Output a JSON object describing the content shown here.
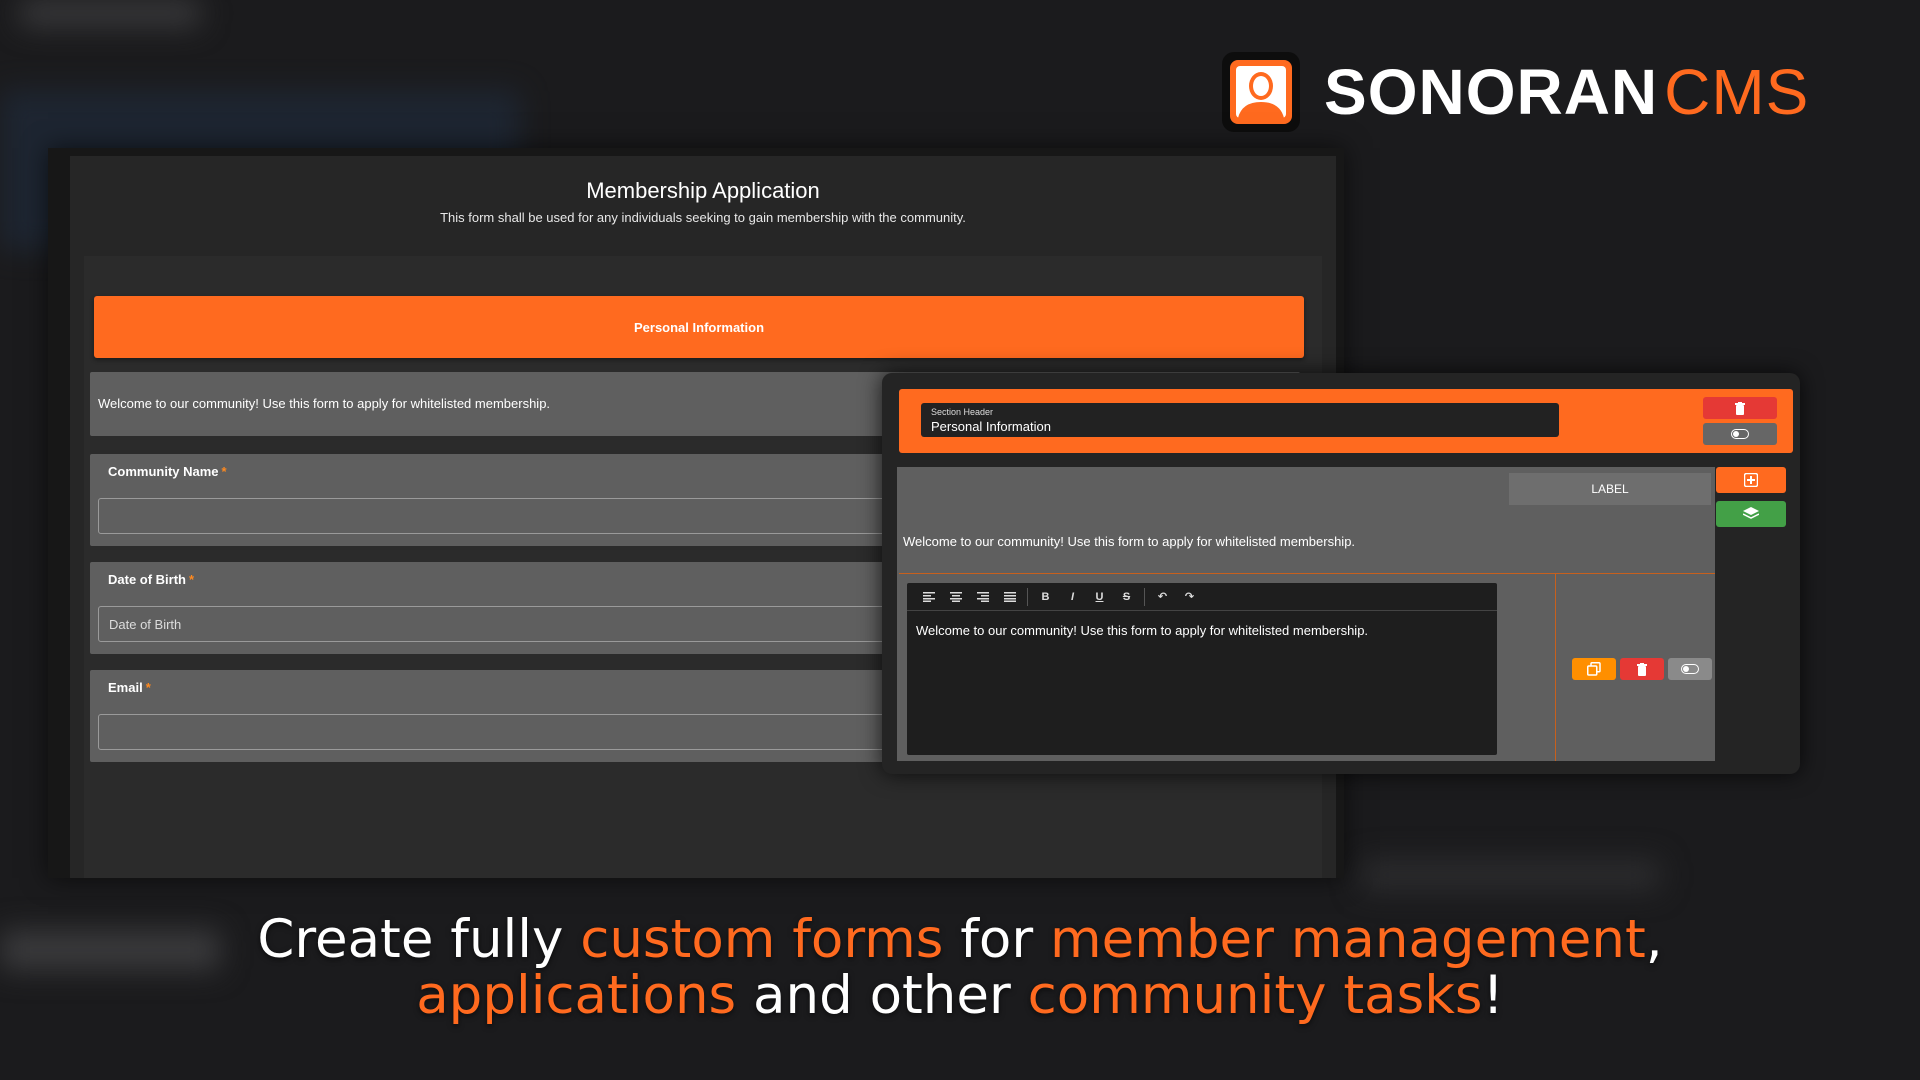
{
  "brand": {
    "word1": "SONORAN",
    "word2": "CMS",
    "accent": "#ff6a1f"
  },
  "form": {
    "title": "Membership Application",
    "subtitle": "This form shall be used for any individuals seeking to gain membership with the community.",
    "section_header": "Personal Information",
    "welcome_text": "Welcome to our community! Use this form to apply for whitelisted membership.",
    "fields": [
      {
        "label": "Community Name",
        "required_mark": "*",
        "placeholder": "",
        "value": ""
      },
      {
        "label": "Date of Birth",
        "required_mark": "*",
        "placeholder": "Date of Birth",
        "value": ""
      },
      {
        "label": "Email",
        "required_mark": "*",
        "placeholder": "",
        "value": ""
      }
    ]
  },
  "editor": {
    "header_field_label": "Section Header",
    "header_field_value": "Personal Information",
    "label_button": "LABEL",
    "content_text": "Welcome to our community! Use this form to apply for whitelisted membership.",
    "rte_text": "Welcome to our community! Use this form to apply for whitelisted membership.",
    "toolbar": [
      {
        "name": "align-left-icon",
        "glyph": "≡"
      },
      {
        "name": "align-center-icon",
        "glyph": "≡"
      },
      {
        "name": "align-right-icon",
        "glyph": "≡"
      },
      {
        "name": "align-justify-icon",
        "glyph": "≡"
      },
      {
        "name": "bold-icon",
        "glyph": "B"
      },
      {
        "name": "italic-icon",
        "glyph": "I"
      },
      {
        "name": "underline-icon",
        "glyph": "U"
      },
      {
        "name": "strikethrough-icon",
        "glyph": "S"
      },
      {
        "name": "undo-icon",
        "glyph": "↶"
      },
      {
        "name": "redo-icon",
        "glyph": "↷"
      }
    ],
    "colors": {
      "delete": "#e53935",
      "toggle": "#666666",
      "add": "#ff6a1f",
      "layers": "#43a047",
      "copy": "#ff8f00"
    }
  },
  "caption": {
    "p1": "Create fully ",
    "h1": "custom forms",
    "p2": " for ",
    "h2": "member management",
    "p3": ",",
    "h3": "applications",
    "p4": " and other ",
    "h4": "community tasks",
    "p5": "!"
  }
}
